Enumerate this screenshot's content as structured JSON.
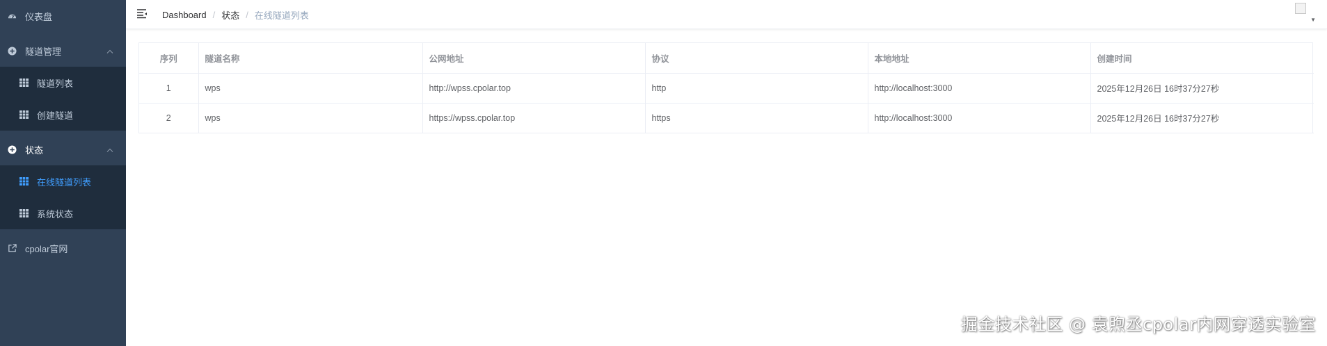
{
  "sidebar": {
    "items": [
      {
        "label": "仪表盘",
        "icon": "dashboard-icon"
      },
      {
        "label": "隧道管理",
        "icon": "plus-circle-icon",
        "expanded": true,
        "children": [
          {
            "label": "隧道列表",
            "icon": "table-icon"
          },
          {
            "label": "创建隧道",
            "icon": "table-icon"
          }
        ]
      },
      {
        "label": "状态",
        "icon": "plus-circle-icon",
        "expanded": true,
        "children": [
          {
            "label": "在线隧道列表",
            "icon": "table-icon",
            "active": true
          },
          {
            "label": "系统状态",
            "icon": "table-icon"
          }
        ]
      },
      {
        "label": "cpolar官网",
        "icon": "external-link-icon"
      }
    ]
  },
  "header": {
    "breadcrumb": [
      "Dashboard",
      "状态",
      "在线隧道列表"
    ]
  },
  "table": {
    "columns": [
      "序列",
      "隧道名称",
      "公网地址",
      "协议",
      "本地地址",
      "创建时间"
    ],
    "rows": [
      [
        "1",
        "wps",
        "http://wpss.cpolar.top",
        "http",
        "http://localhost:3000",
        "2025年12月26日 16时37分27秒"
      ],
      [
        "2",
        "wps",
        "https://wpss.cpolar.top",
        "https",
        "http://localhost:3000",
        "2025年12月26日 16时37分27秒"
      ]
    ]
  },
  "watermark": "掘金技术社区 @ 袁煦丞cpolar内网穿透实验室",
  "colors": {
    "sidebar_bg": "#304156",
    "submenu_bg": "#1f2d3d",
    "sidebar_text": "#bfcbd9",
    "active": "#409eff",
    "table_border": "#ebeef5"
  }
}
